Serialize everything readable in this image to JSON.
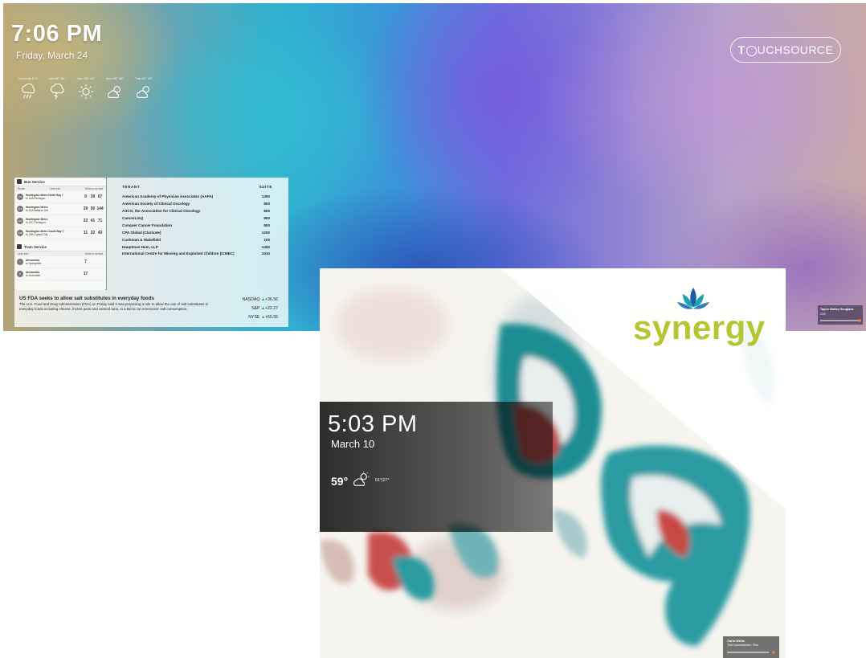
{
  "screen1": {
    "clock": "7:06 PM",
    "date": "Friday, March 24",
    "weather": [
      {
        "label": "Currently 9 °C",
        "icon": "rain-icon"
      },
      {
        "label": "Sat 63° 46°",
        "icon": "thunderstorm-icon"
      },
      {
        "label": "Sun 59° 42°",
        "icon": "sun-icon"
      },
      {
        "label": "Mon 65° 48°",
        "icon": "partly-cloudy-icon"
      },
      {
        "label": "Tue 60° 49°",
        "icon": "partly-cloudy-icon"
      }
    ],
    "brand": {
      "part1": "T",
      "part2": "UCHSOURCE"
    },
    "transit": {
      "bus_title": "Bus Service",
      "bus_col_route": "Route",
      "bus_col_line": "Line Info",
      "bus_col_mins": "Mins to Arrival",
      "bus_rows": [
        {
          "route": "16A",
          "dest": "Huntington Metro North Bay 7",
          "sub": "to 16A Pentagon",
          "times": [
            "9",
            "39",
            "67"
          ]
        },
        {
          "route": "22A",
          "dest": "Huntington Metro",
          "sub": "to 22A Ballston-MU",
          "times": [
            "29",
            "50",
            "144"
          ]
        },
        {
          "route": "22C",
          "dest": "Huntington Metro",
          "sub": "to 22C Pentagon",
          "times": [
            "22",
            "41",
            "71"
          ]
        },
        {
          "route": "23B",
          "dest": "Huntington Metro South Bay 7",
          "sub": "to 23B Crystal City",
          "times": [
            "11",
            "22",
            "43"
          ]
        }
      ],
      "train_title": "Train Service",
      "train_col_line": "Line Info",
      "train_col_mins": "Mins to Arrival",
      "train_rows": [
        {
          "route": "Y",
          "dest": "Alexandria",
          "sub": "to Springfield",
          "times": [
            "7",
            "",
            ""
          ]
        },
        {
          "route": "B",
          "dest": "Alexandria",
          "sub": "to Greenbelt",
          "times": [
            "17",
            "",
            ""
          ]
        }
      ]
    },
    "directory": {
      "col_tenant": "TENANT",
      "col_suite": "SUITE",
      "rows": [
        {
          "name": "American Academy of Physician Associates (AAPA)",
          "suite": "1300"
        },
        {
          "name": "American Society of Clinical Oncology",
          "suite": "800"
        },
        {
          "name": "ASCO, the Association for Clinical Oncology",
          "suite": "800"
        },
        {
          "name": "CancerLinQ",
          "suite": "800"
        },
        {
          "name": "Conquer Cancer Foundation",
          "suite": "800"
        },
        {
          "name": "CPA Global (Clarivate)",
          "suite": "1200"
        },
        {
          "name": "Cushman & Wakefield",
          "suite": "100"
        },
        {
          "name": "Hauptman Ham, LLP",
          "suite": "1400"
        },
        {
          "name": "International Centre for Missing and Exploited Children (ICMEC)",
          "suite": "1010"
        }
      ]
    },
    "news": {
      "headline": "US FDA seeks to allow salt substitutes in everyday foods",
      "body": "The U.S. Food and Drug Administration (FDA) on Friday said it was proposing a rule to allow the use of salt substitutes in everyday foods including cheese, frozen peas and canned tuna, in a bid to cut Americans' salt consumption."
    },
    "stocks": [
      {
        "name": "NASDAQ",
        "change": "+36.56"
      },
      {
        "name": "S&P",
        "change": "+22.27"
      },
      {
        "name": "NYSE",
        "change": "+65.55"
      }
    ],
    "person_card": {
      "name": "Taylor Bailey Douglass",
      "role": "CNS"
    }
  },
  "screen2": {
    "clock": "5:03 PM",
    "date": "March 10",
    "temp": "59°",
    "weather_icon": "partly-cloudy-icon",
    "range": "51°|27°",
    "brand_word": "synergy",
    "brand_color": "#b5c534",
    "person_card": {
      "name": "Carla White",
      "role": "Trail Commissioner, Ohio"
    }
  }
}
